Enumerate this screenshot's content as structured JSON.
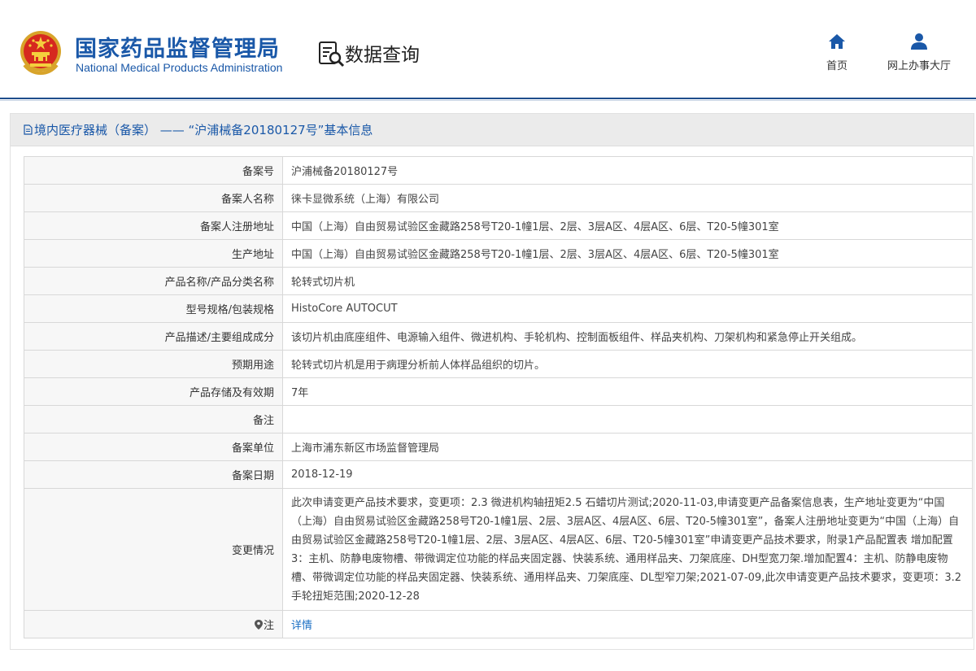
{
  "header": {
    "org_name_cn": "国家药品监督管理局",
    "org_name_en": "National Medical Products Administration",
    "page_title": "数据查询",
    "nav": {
      "home_label": "首页",
      "hall_label": "网上办事大厅"
    }
  },
  "panel": {
    "title": "境内医疗器械（备案） —— “沪浦械备20180127号”基本信息"
  },
  "record": {
    "rows": [
      {
        "label": "备案号",
        "value": "沪浦械备20180127号"
      },
      {
        "label": "备案人名称",
        "value": "徕卡显微系统（上海）有限公司"
      },
      {
        "label": "备案人注册地址",
        "value": "中国（上海）自由贸易试验区金藏路258号T20-1幢1层、2层、3层A区、4层A区、6层、T20-5幢301室"
      },
      {
        "label": "生产地址",
        "value": "中国（上海）自由贸易试验区金藏路258号T20-1幢1层、2层、3层A区、4层A区、6层、T20-5幢301室"
      },
      {
        "label": "产品名称/产品分类名称",
        "value": "轮转式切片机"
      },
      {
        "label": "型号规格/包装规格",
        "value": "HistoCore AUTOCUT"
      },
      {
        "label": "产品描述/主要组成成分",
        "value": "该切片机由底座组件、电源输入组件、微进机构、手轮机构、控制面板组件、样品夹机构、刀架机构和紧急停止开关组成。"
      },
      {
        "label": "预期用途",
        "value": "轮转式切片机是用于病理分析前人体样品组织的切片。"
      },
      {
        "label": "产品存储及有效期",
        "value": "7年"
      },
      {
        "label": "备注",
        "value": ""
      },
      {
        "label": "备案单位",
        "value": "上海市浦东新区市场监督管理局"
      },
      {
        "label": "备案日期",
        "value": "2018-12-19"
      }
    ],
    "change_label": "变更情况",
    "change_value": "此次申请变更产品技术要求，变更项：2.3 微进机构轴扭矩2.5 石蜡切片测试;2020-11-03,申请变更产品备案信息表，生产地址变更为“中国（上海）自由贸易试验区金藏路258号T20-1幢1层、2层、3层A区、4层A区、6层、T20-5幢301室”，备案人注册地址变更为“中国（上海）自由贸易试验区金藏路258号T20-1幢1层、2层、3层A区、4层A区、6层、T20-5幢301室”申请变更产品技术要求，附录1产品配置表 增加配置3：主机、防静电废物槽、带微调定位功能的样品夹固定器、快装系统、通用样品夹、刀架底座、DH型宽刀架.增加配置4：主机、防静电废物槽、带微调定位功能的样品夹固定器、快装系统、通用样品夹、刀架底座、DL型窄刀架;2021-07-09,此次申请变更产品技术要求，变更项：3.2 手轮扭矩范围;2020-12-28",
    "note_label": "注",
    "note_link": "详情"
  },
  "colors": {
    "brand_blue": "#1a58a8",
    "link_blue": "#1a6fc4",
    "label_bg": "#f7f7f7",
    "title_bar_bg": "#ebebeb"
  },
  "icons": {
    "emblem": "national-emblem-icon",
    "query": "data-query-icon",
    "home": "home-icon",
    "hall": "user-icon",
    "doc": "document-icon",
    "pin": "location-pin-icon"
  }
}
